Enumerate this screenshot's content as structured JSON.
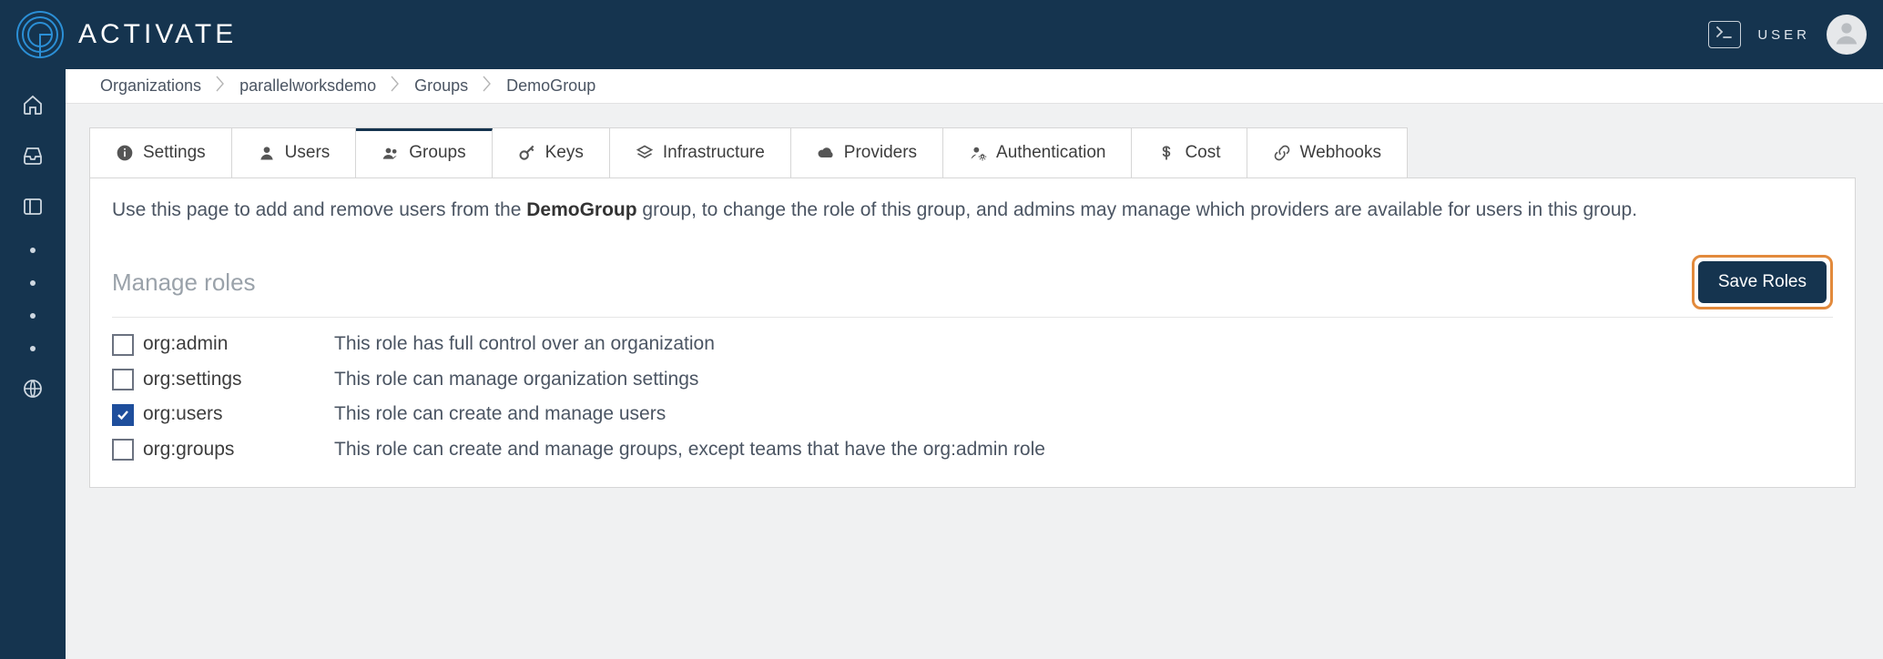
{
  "header": {
    "logo_text": "ACTIVATE",
    "user_label": "USER"
  },
  "breadcrumb": [
    "Organizations",
    "parallelworksdemo",
    "Groups",
    "DemoGroup"
  ],
  "tabs": [
    {
      "id": "settings",
      "label": "Settings",
      "icon": "info"
    },
    {
      "id": "users",
      "label": "Users",
      "icon": "user"
    },
    {
      "id": "groups",
      "label": "Groups",
      "icon": "users",
      "active": true
    },
    {
      "id": "keys",
      "label": "Keys",
      "icon": "key"
    },
    {
      "id": "infrastructure",
      "label": "Infrastructure",
      "icon": "layers"
    },
    {
      "id": "providers",
      "label": "Providers",
      "icon": "cloud"
    },
    {
      "id": "authentication",
      "label": "Authentication",
      "icon": "user-gear"
    },
    {
      "id": "cost",
      "label": "Cost",
      "icon": "dollar"
    },
    {
      "id": "webhooks",
      "label": "Webhooks",
      "icon": "link"
    }
  ],
  "intro": {
    "prefix": "Use this page to add and remove users from the ",
    "group_name": "DemoGroup",
    "suffix": " group, to change the role of this group, and admins may manage which providers are available for users in this group."
  },
  "roles_section": {
    "title": "Manage roles",
    "save_label": "Save Roles"
  },
  "roles": [
    {
      "name": "org:admin",
      "desc": "This role has full control over an organization",
      "checked": false
    },
    {
      "name": "org:settings",
      "desc": "This role can manage organization settings",
      "checked": false
    },
    {
      "name": "org:users",
      "desc": "This role can create and manage users",
      "checked": true
    },
    {
      "name": "org:groups",
      "desc": "This role can create and manage groups, except teams that have the org:admin role",
      "checked": false
    }
  ]
}
